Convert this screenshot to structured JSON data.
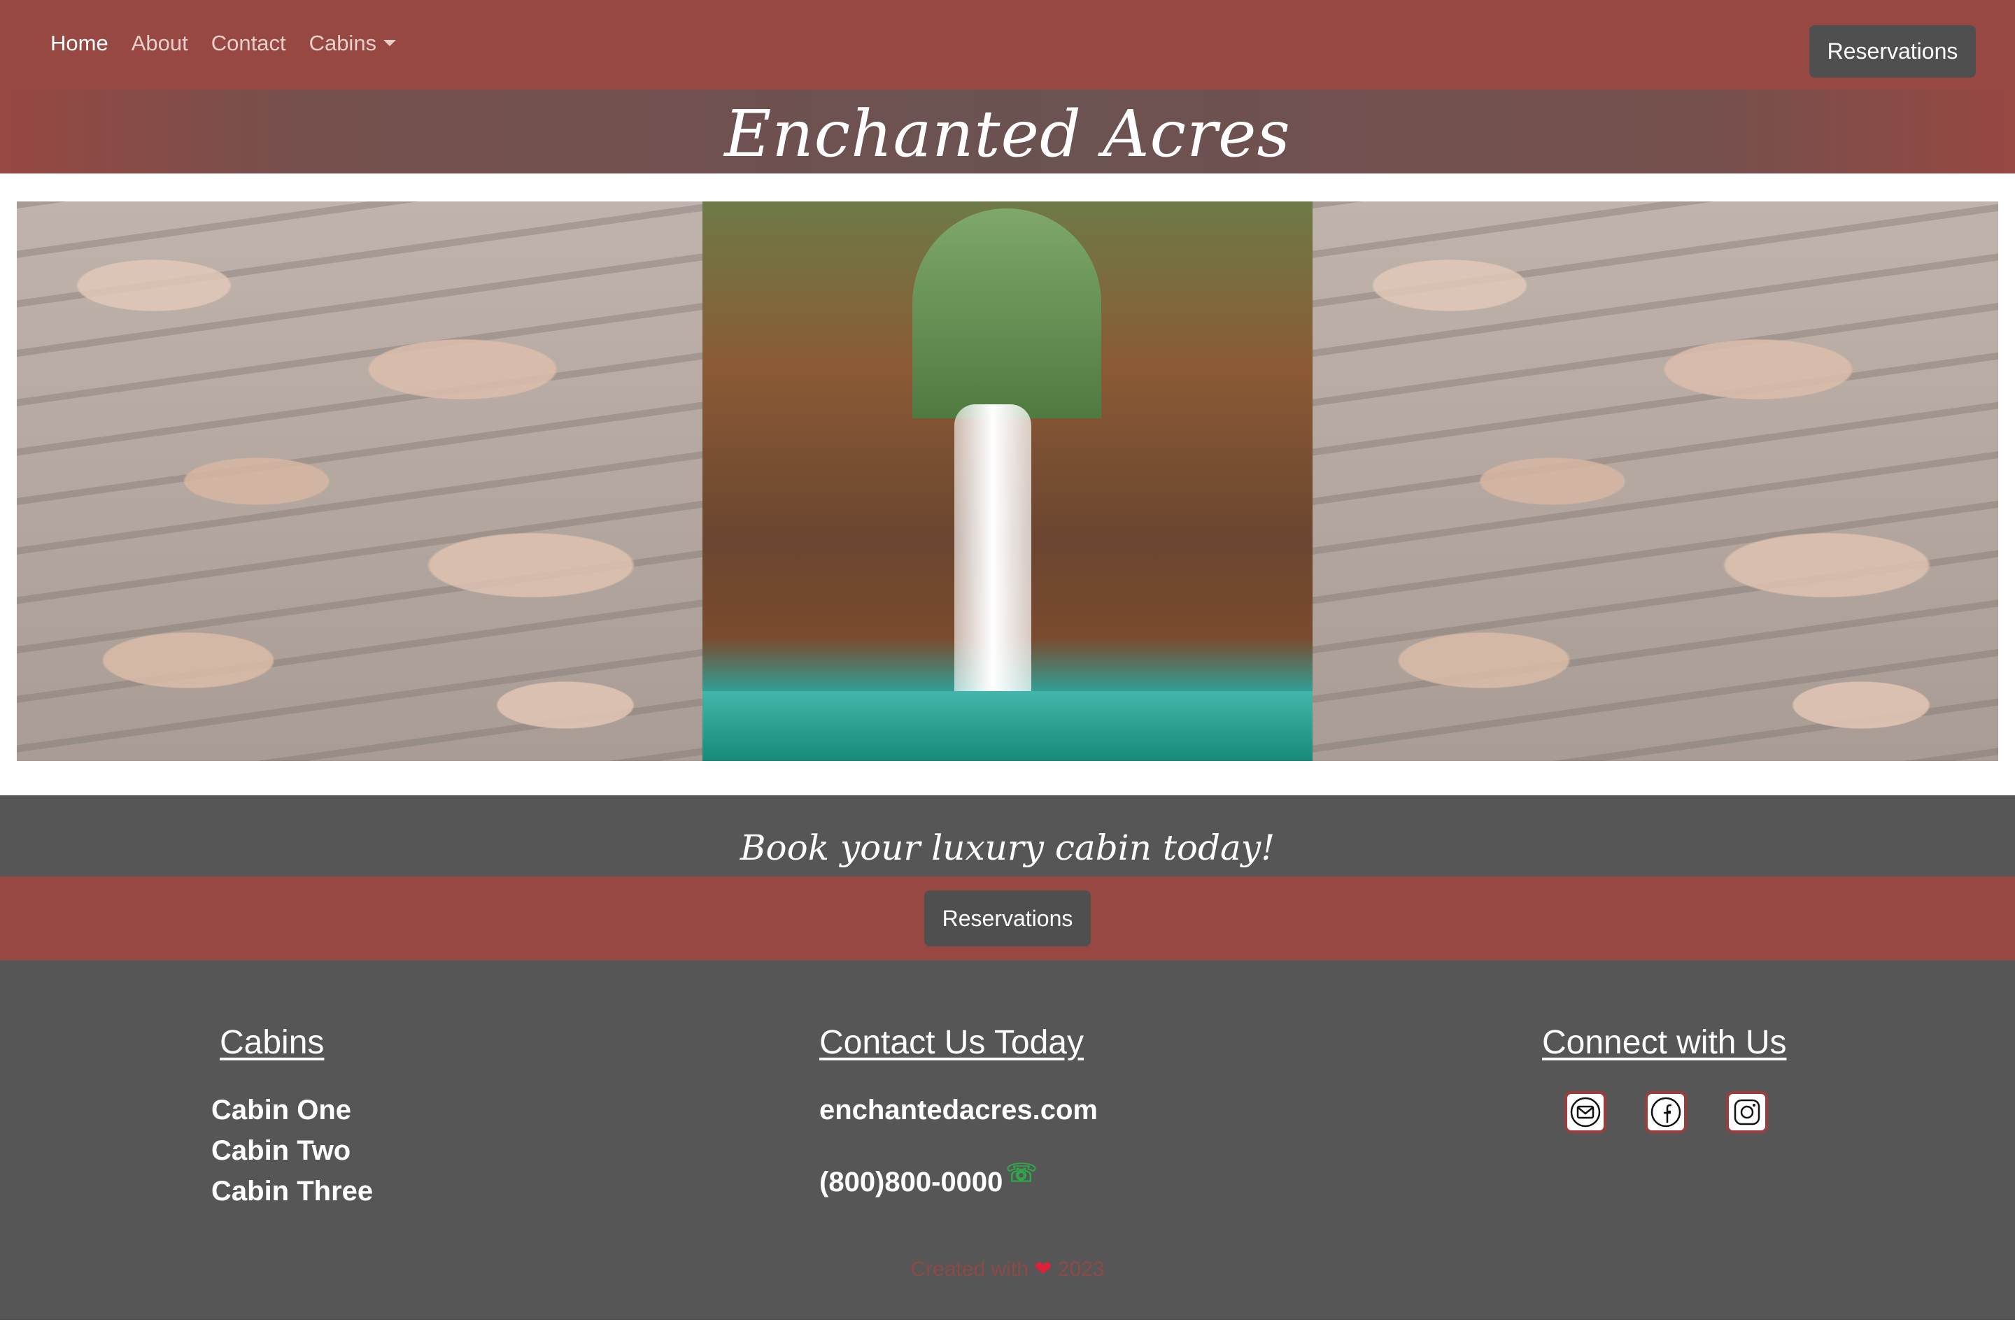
{
  "nav": {
    "links": [
      "Home",
      "About",
      "Contact",
      "Cabins"
    ],
    "reservations_label": "Reservations"
  },
  "header": {
    "title": "Enchanted Acres"
  },
  "book": {
    "tagline": "Book your luxury cabin today!",
    "button_label": "Reservations"
  },
  "footer": {
    "cabins": {
      "heading": "Cabins",
      "items": [
        "Cabin One",
        "Cabin Two",
        "Cabin Three"
      ]
    },
    "contact": {
      "heading": "Contact Us Today",
      "website": "enchantedacres.com",
      "phone": "(800)800-0000"
    },
    "connect": {
      "heading": "Connect with Us",
      "icons": [
        "mail-icon",
        "facebook-icon",
        "instagram-icon"
      ]
    },
    "credit": {
      "prefix": "Created with",
      "year": "2023"
    }
  },
  "colors": {
    "brand": "#974842",
    "dark": "#565656",
    "button": "#4f4f4f"
  }
}
